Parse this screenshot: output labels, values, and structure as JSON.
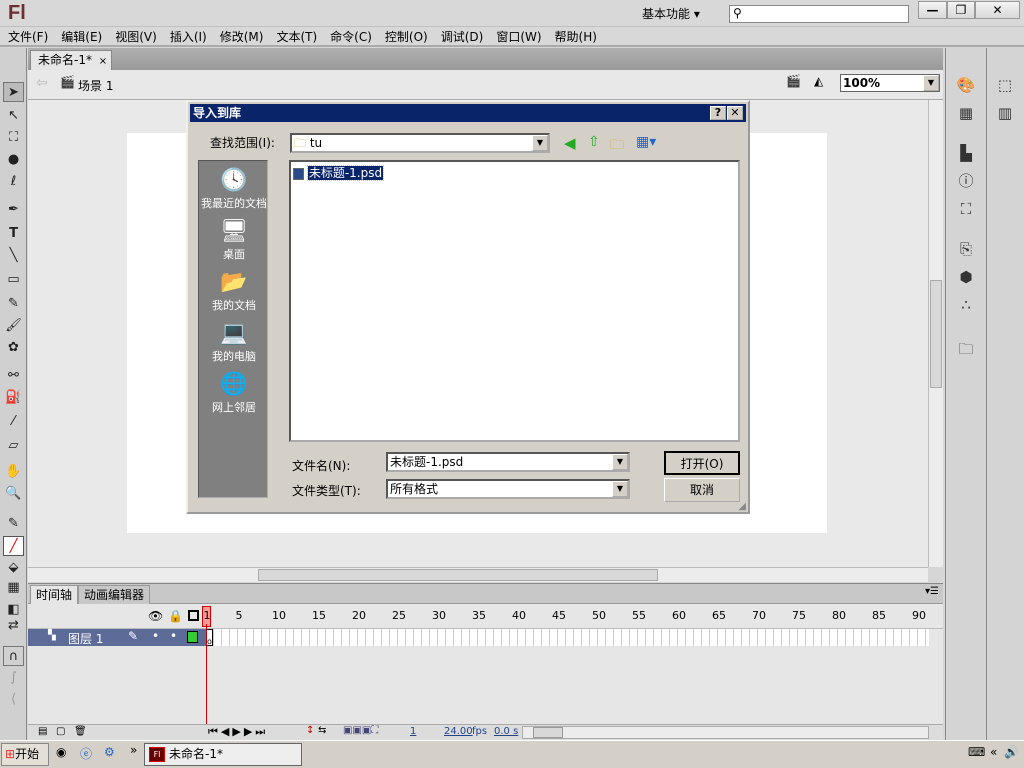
{
  "app": {
    "logo": "Fl",
    "workspace": "基本功能 ▾",
    "search_placeholder": ""
  },
  "window_buttons": {
    "minimize": "—",
    "restore": "❐",
    "close": "✕"
  },
  "menu": [
    "文件(F)",
    "编辑(E)",
    "视图(V)",
    "插入(I)",
    "修改(M)",
    "文本(T)",
    "命令(C)",
    "控制(O)",
    "调试(D)",
    "窗口(W)",
    "帮助(H)"
  ],
  "document": {
    "tab": "未命名-1*",
    "tab_close": "×",
    "scene": "场景 1",
    "zoom": "100%"
  },
  "timeline": {
    "tabs": [
      "时间轴",
      "动画编辑器"
    ],
    "frame_numbers": [
      1,
      5,
      10,
      15,
      20,
      25,
      30,
      35,
      40,
      45,
      50,
      55,
      60,
      65,
      70,
      75,
      80,
      85,
      90
    ],
    "layer": "图层 1",
    "current_frame": "1",
    "fps": "24.00",
    "fps_unit": "fps",
    "time": "0.0 s"
  },
  "dialog": {
    "title": "导入到库",
    "help": "?",
    "close": "✕",
    "look_in_label": "查找范围(I):",
    "look_in_value": "tu",
    "places": [
      "我最近的文档",
      "桌面",
      "我的文档",
      "我的电脑",
      "网上邻居"
    ],
    "files": [
      "未标题-1.psd"
    ],
    "filename_label": "文件名(N):",
    "filename_value": "未标题-1.psd",
    "filetype_label": "文件类型(T):",
    "filetype_value": "所有格式",
    "open_button": "打开(O)",
    "cancel_button": "取消"
  },
  "taskbar": {
    "start": "开始",
    "task": "未命名-1*",
    "more": "»"
  },
  "colors": {
    "dialog_title": "#0a246a",
    "layer_row": "#5d6b99",
    "playhead": "#cc0000",
    "selection": "#0a246a"
  }
}
